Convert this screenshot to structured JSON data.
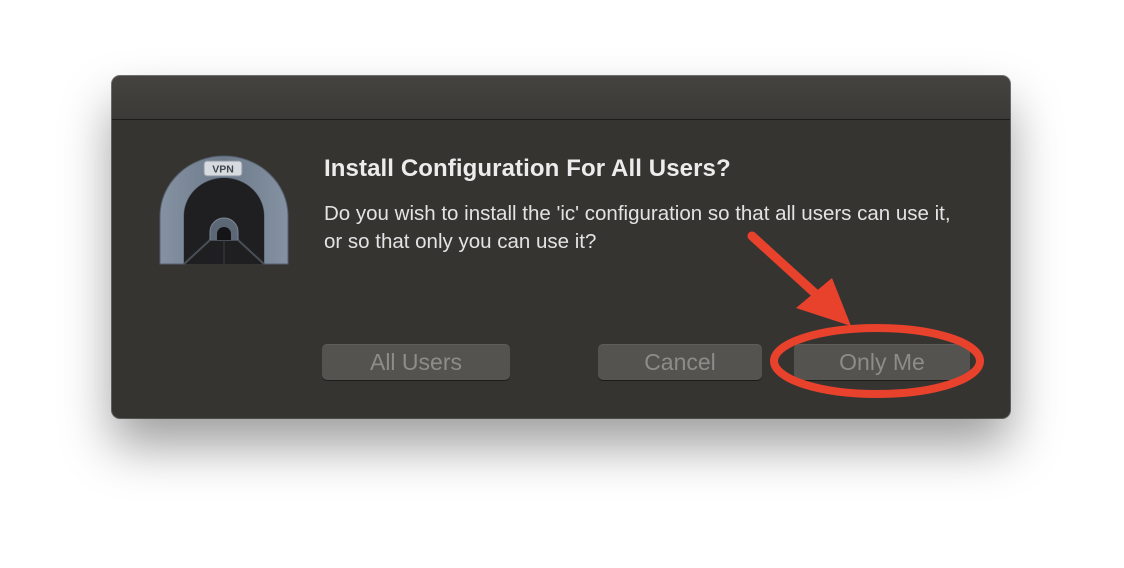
{
  "dialog": {
    "icon": "vpn-tunnel-icon",
    "icon_badge": "VPN",
    "title": "Install Configuration For All Users?",
    "message": "Do you wish to install the 'ic' configuration so that all users can use it, or so that only you can use it?",
    "buttons": {
      "all_users": "All Users",
      "cancel": "Cancel",
      "only_me": "Only Me"
    }
  },
  "annotation": {
    "arrow": "arrow-icon",
    "highlight": "circle-highlight",
    "color": "#e8412c"
  },
  "colors": {
    "dialog_background": "#363431",
    "button_background": "#555350",
    "button_text": "#8e8c89"
  }
}
